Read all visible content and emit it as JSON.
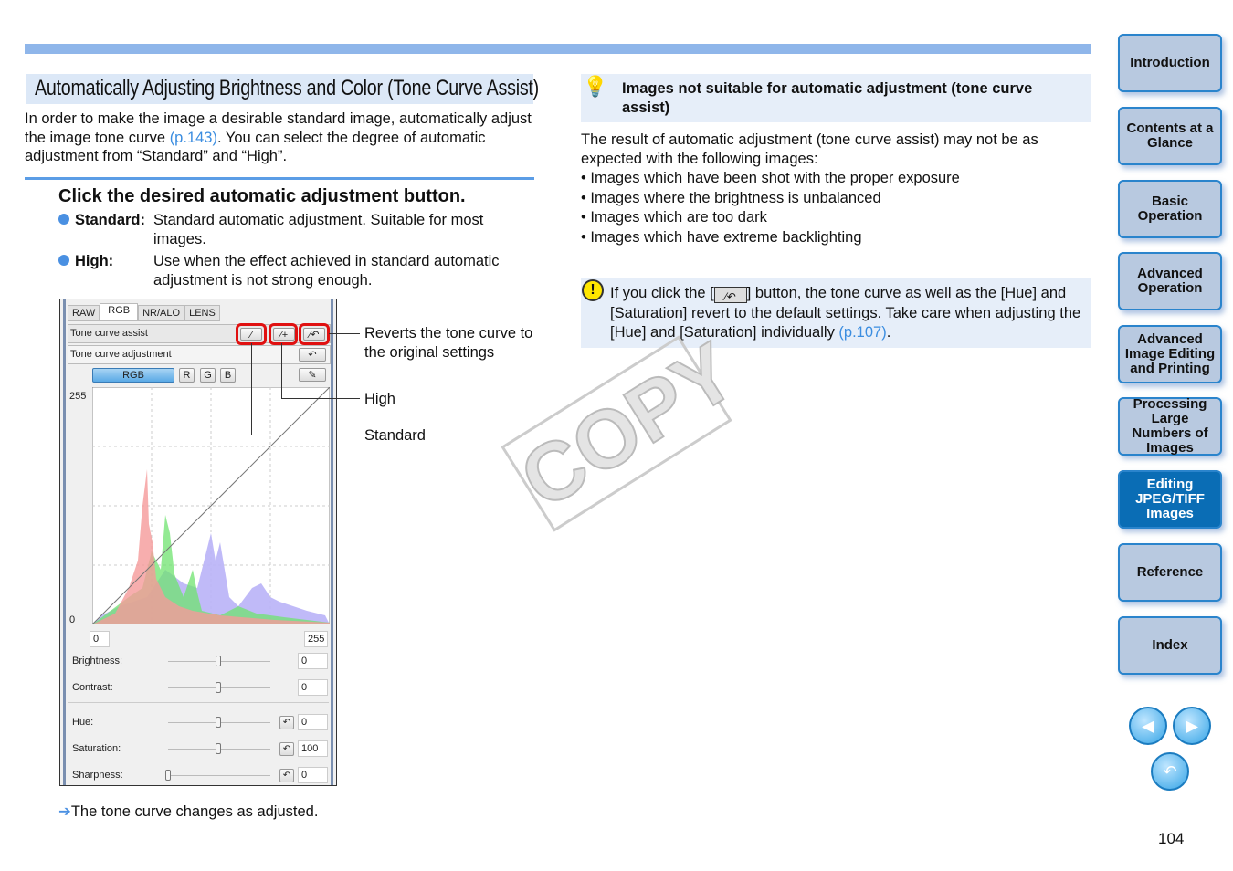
{
  "title": "Automatically Adjusting Brightness and Color (Tone Curve Assist)",
  "intro": {
    "text1": "In order to make the image a desirable standard image, automatically adjust the image tone curve ",
    "link": "(p.143)",
    "text2": ". You can select the degree of automatic adjustment from “Standard” and “High”."
  },
  "step": {
    "heading": "Click the desired automatic adjustment button.",
    "items": [
      {
        "label": "Standard:",
        "desc": "Standard automatic adjustment. Suitable for most images."
      },
      {
        "label": "High:",
        "desc": "Use when the effect achieved in standard automatic adjustment is not strong enough."
      }
    ]
  },
  "panel": {
    "tabs": [
      "RAW",
      "RGB",
      "NR/ALO",
      "LENS"
    ],
    "active_tab": "RGB",
    "tone_curve_assist": "Tone curve assist",
    "tone_curve_adjustment": "Tone curve adjustment",
    "channels": [
      "RGB",
      "R",
      "G",
      "B"
    ],
    "y_max": "255",
    "y_min": "0",
    "in_field": "0",
    "out_field": "255",
    "sliders": [
      {
        "label": "Brightness:",
        "value": "0",
        "pos": 0.5
      },
      {
        "label": "Contrast:",
        "value": "0",
        "pos": 0.5
      },
      {
        "label": "Hue:",
        "value": "0",
        "pos": 0.5
      },
      {
        "label": "Saturation:",
        "value": "100",
        "pos": 0.5
      },
      {
        "label": "Sharpness:",
        "value": "0",
        "pos": 0
      }
    ]
  },
  "callouts": {
    "revert": "Reverts the tone curve to the original settings",
    "high": "High",
    "standard": "Standard"
  },
  "result": "The tone curve changes as adjusted.",
  "tip": {
    "heading": "Images not suitable for automatic adjustment (tone curve assist)",
    "body": "The result of automatic adjustment (tone curve assist) may not be as expected with the following images:",
    "bullets": [
      "• Images which have been shot with the proper exposure",
      "• Images where the brightness is unbalanced",
      "• Images which are too dark",
      "• Images which have extreme backlighting"
    ]
  },
  "caution": {
    "text1": "If you click the [",
    "text2": "] button, the tone curve as well as the [Hue] and [Saturation] revert to the default settings. Take care when adjusting the [Hue] and [Saturation] individually ",
    "link": "(p.107)",
    "text3": "."
  },
  "watermark": "COPY",
  "sidebar": [
    "Introduction",
    "Contents at a Glance",
    "Basic Operation",
    "Advanced Operation",
    "Advanced Image Editing and Printing",
    "Processing Large Numbers of Images",
    "Editing JPEG/TIFF Images",
    "Reference",
    "Index"
  ],
  "active_section": "Editing JPEG/TIFF Images",
  "page_number": "104"
}
